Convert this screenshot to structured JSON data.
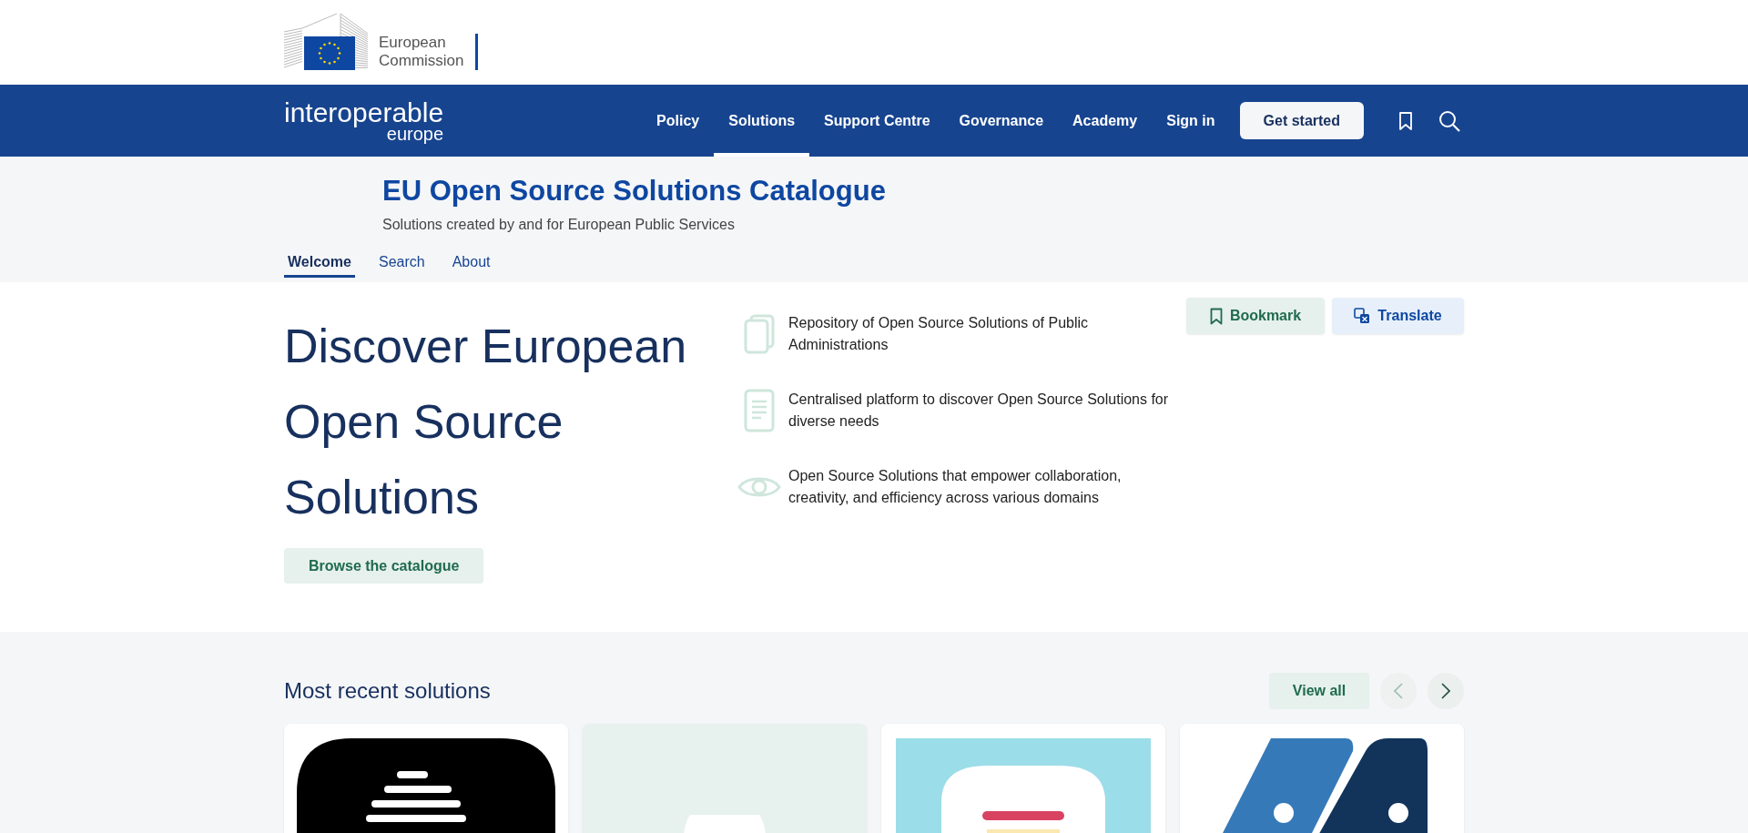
{
  "header": {
    "logo_text": [
      "European",
      "Commission"
    ]
  },
  "navbar": {
    "brand": "interoperable",
    "brand_sub": "europe",
    "items": [
      {
        "label": "Policy",
        "selected": false
      },
      {
        "label": "Solutions",
        "selected": true
      },
      {
        "label": "Support Centre",
        "selected": false
      },
      {
        "label": "Governance",
        "selected": false
      },
      {
        "label": "Academy",
        "selected": false
      },
      {
        "label": "Sign in",
        "selected": false
      }
    ],
    "cta": "Get started"
  },
  "page_header": {
    "title": "EU Open Source Solutions Catalogue",
    "subtitle": "Solutions created by and for European Public Services",
    "tabs": [
      {
        "label": "Welcome",
        "selected": true
      },
      {
        "label": "Search",
        "selected": false
      },
      {
        "label": "About",
        "selected": false
      }
    ]
  },
  "hero": {
    "title": "Discover European Open Source Solutions",
    "button": "Browse the catalogue",
    "features": [
      {
        "kind": "stack",
        "text": "Repository of Open Source Solutions of Public Administrations"
      },
      {
        "kind": "document",
        "text": "Centralised platform to discover Open Source Solutions for diverse needs"
      },
      {
        "kind": "eye",
        "text": "Open Source Solutions that empower collaboration, creativity, and efficiency across various domains"
      }
    ],
    "actions": [
      {
        "kind": "bookmark",
        "label": "Bookmark"
      },
      {
        "kind": "translate",
        "label": "Translate"
      }
    ]
  },
  "recent": {
    "title": "Most recent solutions",
    "view_all": "View all",
    "prev_disabled": true,
    "cards": [
      {
        "kind": "bars"
      },
      {
        "kind": "placeholder"
      },
      {
        "kind": "note"
      },
      {
        "kind": "slants"
      }
    ]
  }
}
